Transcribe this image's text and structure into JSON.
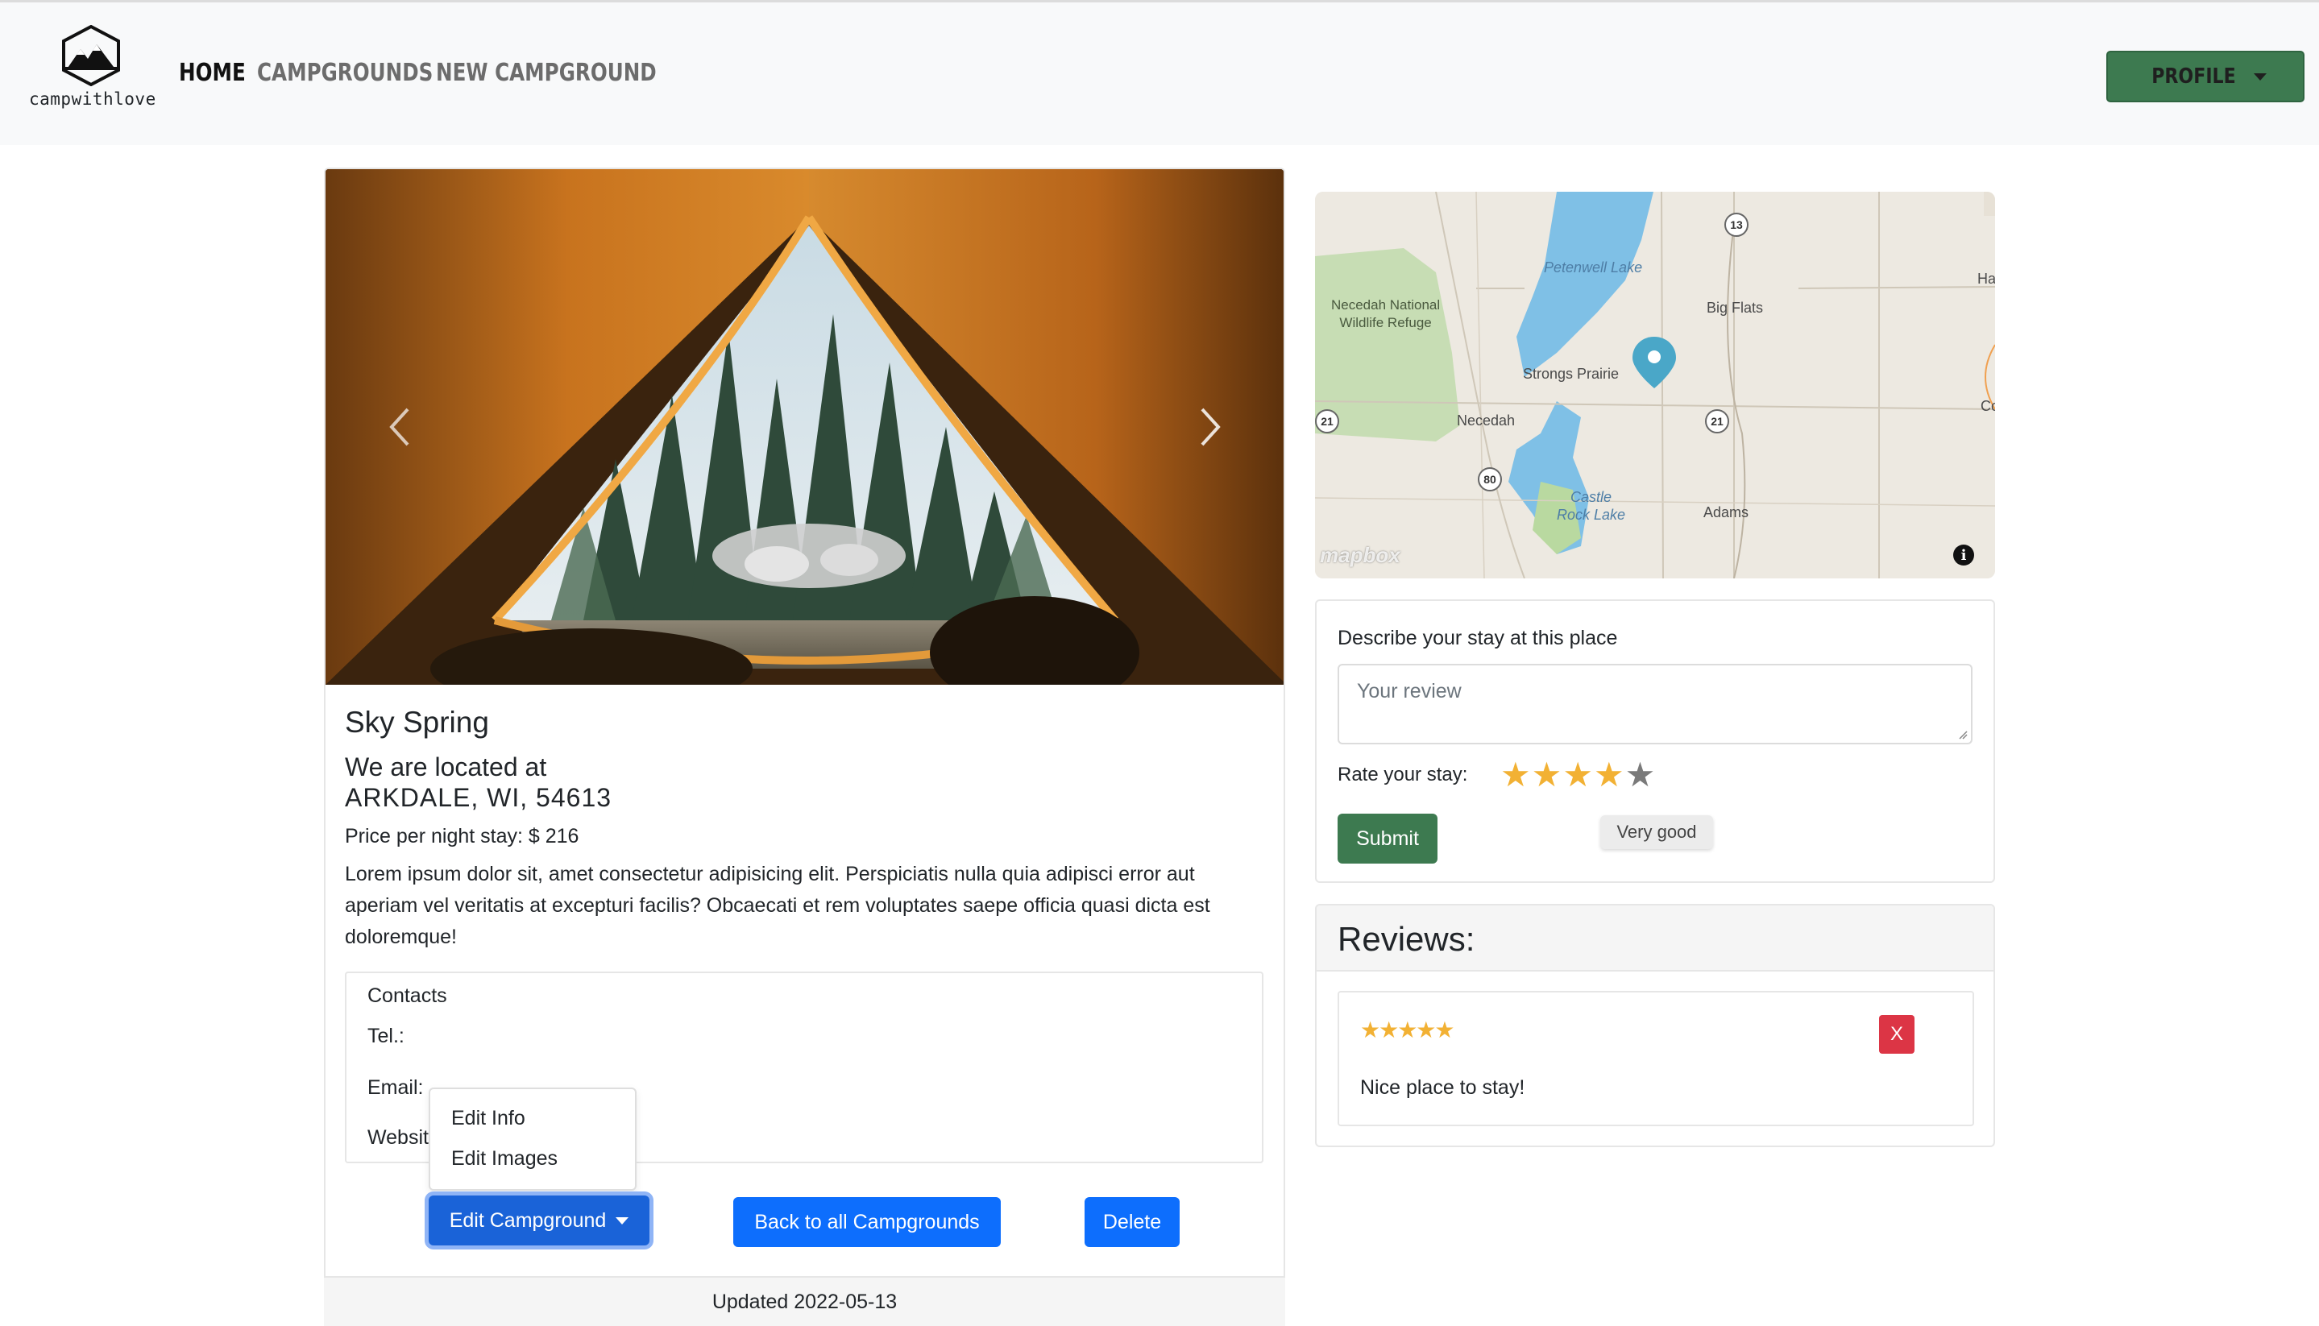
{
  "navbar": {
    "brand": "campwithlove",
    "links": {
      "home": "HOME",
      "campgrounds": "CAMPGROUNDS",
      "new_campground": "NEW CAMPGROUND"
    },
    "profile_label": "PROFILE"
  },
  "campground": {
    "title": "Sky Spring",
    "location_label": "We are located at",
    "location": "ARKDALE, WI, 54613",
    "price": "Price per night stay: $ 216",
    "description": "Lorem ipsum dolor sit, amet consectetur adipisicing elit. Perspiciatis nulla quia adipisci error aut aperiam vel veritatis at excepturi facilis? Obcaecati et rem voluptates saepe officia quasi dicta est doloremque!",
    "contacts": {
      "title": "Contacts",
      "tel": "Tel.:",
      "email": "Email:",
      "website": "Websit"
    },
    "edit_menu": {
      "edit_info": "Edit Info",
      "edit_images": "Edit Images"
    },
    "buttons": {
      "edit": "Edit Campground",
      "back": "Back to all Campgrounds",
      "delete": "Delete"
    },
    "updated": "Updated 2022-05-13"
  },
  "map": {
    "labels": {
      "petenwell": "Petenwell Lake",
      "necedah_refuge": "Necedah National\nWildlife Refuge",
      "big_flats": "Big Flats",
      "strongs_prairie": "Strongs Prairie",
      "necedah": "Necedah",
      "castle_rock": "Castle\nRock Lake",
      "adams": "Adams",
      "ha": "Ha",
      "co": "Co"
    },
    "routes": {
      "r13": "13",
      "r21a": "21",
      "r21b": "21",
      "r80": "80"
    },
    "attribution": "mapbox",
    "info": "i"
  },
  "review_form": {
    "label": "Describe your stay at this place",
    "placeholder": "Your review",
    "rate_label": "Rate your stay:",
    "rating": 4,
    "rating_max": 5,
    "tooltip": "Very good",
    "submit": "Submit"
  },
  "reviews": {
    "title": "Reviews:",
    "items": [
      {
        "stars": "★★★★★",
        "text": "Nice place to stay!",
        "delete_label": "X"
      }
    ]
  },
  "colors": {
    "primary": "#0d6efd",
    "success": "#3d7a50",
    "danger": "#dc3545",
    "star": "#f2b134"
  }
}
